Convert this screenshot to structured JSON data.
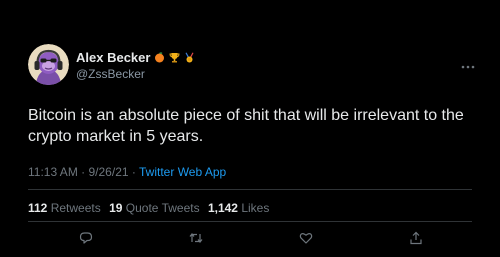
{
  "author": {
    "name": "Alex Becker",
    "handle": "@ZssBecker",
    "badges": [
      "orange-icon",
      "trophy-icon",
      "medal-icon"
    ]
  },
  "tweet": {
    "text": "Bitcoin is an absolute piece of shit that will be irrelevant to the crypto market in 5 years.",
    "time": "11:13 AM",
    "date": "9/26/21",
    "separator": "·",
    "source": "Twitter Web App"
  },
  "stats": {
    "retweets": {
      "count": "112",
      "label": "Retweets"
    },
    "quotes": {
      "count": "19",
      "label": "Quote Tweets"
    },
    "likes": {
      "count": "1,142",
      "label": "Likes"
    }
  },
  "actions": [
    "reply-icon",
    "retweet-icon",
    "like-icon",
    "share-icon"
  ],
  "colors": {
    "background": "#000000",
    "text": "#e7e9ea",
    "secondary": "#6e767d",
    "accent": "#1d9bf0",
    "divider": "#2f3336"
  }
}
